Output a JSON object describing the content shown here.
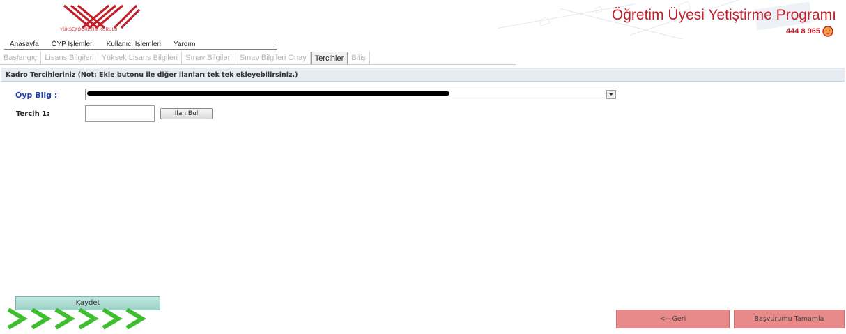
{
  "header": {
    "logo_text": "YÜKSEKÖĞRETİM KURULU",
    "program_title": "Öğretim Üyesi Yetiştirme Programı",
    "phone": "444 8 965"
  },
  "menu": {
    "items": [
      {
        "label": "Anasayfa"
      },
      {
        "label": "ÖYP İşlemleri"
      },
      {
        "label": "Kullanıcı İşlemleri"
      },
      {
        "label": "Yardım"
      }
    ]
  },
  "steps": {
    "items": [
      {
        "label": "Başlangıç",
        "active": false
      },
      {
        "label": "Lisans Bilgileri",
        "active": false
      },
      {
        "label": "Yüksek Lisans Bilgileri",
        "active": false
      },
      {
        "label": "Sınav Bilgileri",
        "active": false
      },
      {
        "label": "Sınav Bilgileri Onay",
        "active": false
      },
      {
        "label": "Tercihler",
        "active": true
      },
      {
        "label": "Bitiş",
        "active": false
      }
    ]
  },
  "section": {
    "title": "Kadro Tercihleriniz (Not: Ekle butonu ile diğer ilanları tek tek ekleyebilirsiniz.)"
  },
  "form": {
    "oyp_label": "Öyp Bilg :",
    "oyp_value": "",
    "tercih_label": "Tercih 1:",
    "tercih_value": "",
    "ilan_bul_label": "Ilan Bul"
  },
  "footer": {
    "kaydet_label": "Kaydet",
    "geri_label": "<-- Geri",
    "tamamla_label": "Başvurumu Tamamla"
  },
  "colors": {
    "brand_red": "#c0202a",
    "tab_active_bg": "#f2f2f2",
    "section_bg": "#e6ecf2",
    "label_blue": "#1f3fa8",
    "save_green": "#9ed2c8",
    "nav_red": "#e88a8a",
    "arrow_green": "#3fbf2f"
  }
}
